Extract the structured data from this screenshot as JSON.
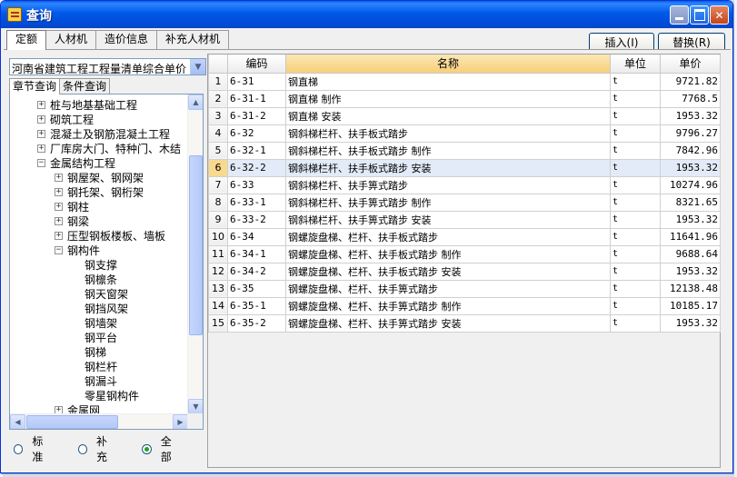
{
  "window": {
    "title": "查询"
  },
  "top_tabs": [
    {
      "label": "定额",
      "active": true
    },
    {
      "label": "人材机",
      "active": false
    },
    {
      "label": "造价信息",
      "active": false
    },
    {
      "label": "补充人材机",
      "active": false
    }
  ],
  "actions": {
    "insert_label": "插入(I)",
    "replace_label": "替换(R)"
  },
  "left": {
    "combo_value": "河南省建筑工程工程量清单综合单价",
    "sub_tabs": [
      {
        "label": "章节查询",
        "active": true
      },
      {
        "label": "条件查询",
        "active": false
      }
    ],
    "tree": [
      {
        "label": "桩与地基基础工程",
        "level": 0,
        "expander": "+"
      },
      {
        "label": "砌筑工程",
        "level": 0,
        "expander": "+"
      },
      {
        "label": "混凝土及钢筋混凝土工程",
        "level": 0,
        "expander": "+"
      },
      {
        "label": "厂库房大门、特种门、木结",
        "level": 0,
        "expander": "+"
      },
      {
        "label": "金属结构工程",
        "level": 0,
        "expander": "-"
      },
      {
        "label": "钢屋架、钢网架",
        "level": 1,
        "expander": "+"
      },
      {
        "label": "钢托架、钢桁架",
        "level": 1,
        "expander": "+"
      },
      {
        "label": "钢柱",
        "level": 1,
        "expander": "+"
      },
      {
        "label": "钢梁",
        "level": 1,
        "expander": "+"
      },
      {
        "label": "压型钢板楼板、墙板",
        "level": 1,
        "expander": "+"
      },
      {
        "label": "钢构件",
        "level": 1,
        "expander": "-"
      },
      {
        "label": "钢支撑",
        "level": 2,
        "expander": ""
      },
      {
        "label": "钢檩条",
        "level": 2,
        "expander": ""
      },
      {
        "label": "钢天窗架",
        "level": 2,
        "expander": ""
      },
      {
        "label": "钢挡风架",
        "level": 2,
        "expander": ""
      },
      {
        "label": "钢墙架",
        "level": 2,
        "expander": ""
      },
      {
        "label": "钢平台",
        "level": 2,
        "expander": ""
      },
      {
        "label": "钢梯",
        "level": 2,
        "expander": ""
      },
      {
        "label": "钢栏杆",
        "level": 2,
        "expander": ""
      },
      {
        "label": "钢漏斗",
        "level": 2,
        "expander": ""
      },
      {
        "label": "零星钢构件",
        "level": 2,
        "expander": ""
      },
      {
        "label": "金属网",
        "level": 1,
        "expander": "+"
      }
    ],
    "radios": [
      {
        "label": "标准",
        "checked": false
      },
      {
        "label": "补充",
        "checked": false
      },
      {
        "label": "全部",
        "checked": true
      }
    ]
  },
  "grid": {
    "columns": [
      "",
      "编码",
      "名称",
      "单位",
      "单价"
    ],
    "active_column": 2,
    "selected_row": 6,
    "rows": [
      {
        "n": "1",
        "code": "6-31",
        "name": "钢直梯",
        "unit": "t",
        "price": "9721.82"
      },
      {
        "n": "2",
        "code": "6-31-1",
        "name": "钢直梯 制作",
        "unit": "t",
        "price": "7768.5"
      },
      {
        "n": "3",
        "code": "6-31-2",
        "name": "钢直梯 安装",
        "unit": "t",
        "price": "1953.32"
      },
      {
        "n": "4",
        "code": "6-32",
        "name": "钢斜梯栏杆、扶手板式踏步",
        "unit": "t",
        "price": "9796.27"
      },
      {
        "n": "5",
        "code": "6-32-1",
        "name": "钢斜梯栏杆、扶手板式踏步 制作",
        "unit": "t",
        "price": "7842.96"
      },
      {
        "n": "6",
        "code": "6-32-2",
        "name": "钢斜梯栏杆、扶手板式踏步 安装",
        "unit": "t",
        "price": "1953.32"
      },
      {
        "n": "7",
        "code": "6-33",
        "name": "钢斜梯栏杆、扶手箅式踏步",
        "unit": "t",
        "price": "10274.96"
      },
      {
        "n": "8",
        "code": "6-33-1",
        "name": "钢斜梯栏杆、扶手箅式踏步 制作",
        "unit": "t",
        "price": "8321.65"
      },
      {
        "n": "9",
        "code": "6-33-2",
        "name": "钢斜梯栏杆、扶手箅式踏步 安装",
        "unit": "t",
        "price": "1953.32"
      },
      {
        "n": "10",
        "code": "6-34",
        "name": "钢螺旋盘梯、栏杆、扶手板式踏步",
        "unit": "t",
        "price": "11641.96"
      },
      {
        "n": "11",
        "code": "6-34-1",
        "name": "钢螺旋盘梯、栏杆、扶手板式踏步 制作",
        "unit": "t",
        "price": "9688.64"
      },
      {
        "n": "12",
        "code": "6-34-2",
        "name": "钢螺旋盘梯、栏杆、扶手板式踏步 安装",
        "unit": "t",
        "price": "1953.32"
      },
      {
        "n": "13",
        "code": "6-35",
        "name": "钢螺旋盘梯、栏杆、扶手箅式踏步",
        "unit": "t",
        "price": "12138.48"
      },
      {
        "n": "14",
        "code": "6-35-1",
        "name": "钢螺旋盘梯、栏杆、扶手箅式踏步 制作",
        "unit": "t",
        "price": "10185.17"
      },
      {
        "n": "15",
        "code": "6-35-2",
        "name": "钢螺旋盘梯、栏杆、扶手箅式踏步 安装",
        "unit": "t",
        "price": "1953.32"
      }
    ]
  }
}
